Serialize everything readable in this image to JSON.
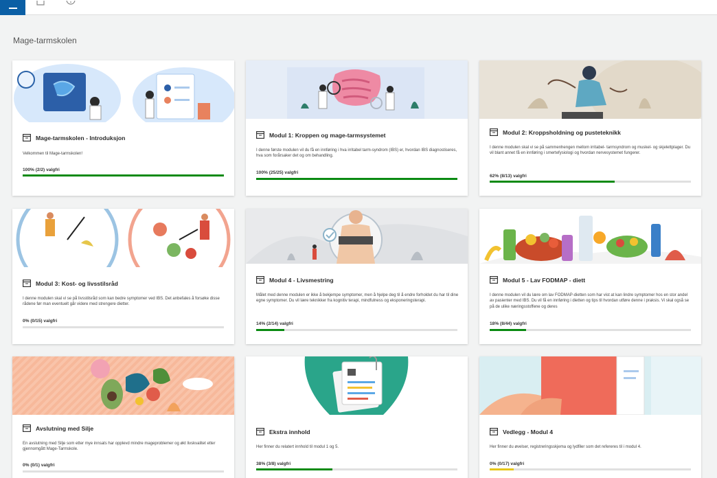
{
  "page": {
    "title": "Mage-tarmskolen"
  },
  "topbar": {
    "menu_icon": "hamburger-menu-icon",
    "home_icon": "home-icon",
    "info_icon": "info-icon",
    "accent": "#0b5fa5"
  },
  "colors": {
    "progress_green": "#0a8a12",
    "progress_yellow": "#e6c619",
    "track": "#e0e0e0"
  },
  "cards": [
    {
      "title": "Mage-tarmskolen - Introduksjon",
      "description": "Velkommen til Mage-tarmskolen!",
      "progress_text": "100% (2/2) valgfri",
      "progress": 1.0,
      "icon": "module-icon"
    },
    {
      "title": "Modul 1: Kroppen og mage-tarmsystemet",
      "description": "I denne første modulen vil du få en innføring i hva irritabel tarm-syndrom (IBS) er, hvordan IBS diagnostiseres, hva som forårsaker det og om behandling.",
      "progress_text": "100% (25/25) valgfri",
      "progress": 1.0,
      "icon": "module-icon"
    },
    {
      "title": "Modul 2: Kroppsholdning og pusteteknikk",
      "description": "I denne modulen skal vi se på sammenhengen mellom irritabel- tarmsyndrom og muskel- og skjelettplager. Du vil blant annet få en innføring i smertefysiologi og hvordan nervesystemet fungerer.",
      "progress_text": "62% (8/13) valgfri",
      "progress": 0.62,
      "icon": "module-icon"
    },
    {
      "title": "Modul 3: Kost- og livsstilsråd",
      "description": "I denne modulen skal vi se på livsstilsråd som kan bedre symptomer ved IBS. Det anbefales å forsøke disse rådene før man eventuelt går videre med strengere dietter.",
      "progress_text": "0% (0/15) valgfri",
      "progress": 0.0,
      "icon": "module-icon"
    },
    {
      "title": "Modul 4 - Livsmestring",
      "description": "Målet med denne modulen er ikke å bekjempe symptomer, men å hjelpe deg til å endre forholdet du har til dine egne symptomer. Du vil lære teknikker fra kognitiv terapi, mindfulness og eksponeringsterapi.",
      "progress_text": "14% (2/14) valgfri",
      "progress": 0.14,
      "icon": "module-icon"
    },
    {
      "title": "Modul 5 - Lav FODMAP - diett",
      "description": "I denne modulen vil du lære om lav FODMAP-dietten som har vist at kan lindre symptomer hos en stor andel av pasienter med IBS. Du vil få en innføring i dietten og tips til hvordan utføre denne i praksis. Vi skal også se på de ulike næringsstoffene og deres",
      "progress_text": "18% (8/44) valgfri",
      "progress": 0.18,
      "icon": "module-icon"
    },
    {
      "title": "Avslutning med Silje",
      "description": "En avslutning med Silje som etter mye innsats har opplevd mindre mageproblemer og økt livskvalitet etter gjennomgått Mage-Tarmskole.",
      "progress_text": "0% (0/1) valgfri",
      "progress": 0.0,
      "icon": "module-icon"
    },
    {
      "title": "Ekstra innhold",
      "description": "Her finner du relatert innhold til modul 1 og 5.",
      "progress_text": "38% (3/8) valgfri",
      "progress": 0.38,
      "icon": "module-icon"
    },
    {
      "title": "Vedlegg - Modul 4",
      "description": "Her finner du øvelser, registreringsskjema og lydfiler som det refereres til i modul 4.",
      "progress_text": "0% (0/17) valgfri",
      "progress": 0.0,
      "icon": "module-icon"
    }
  ]
}
